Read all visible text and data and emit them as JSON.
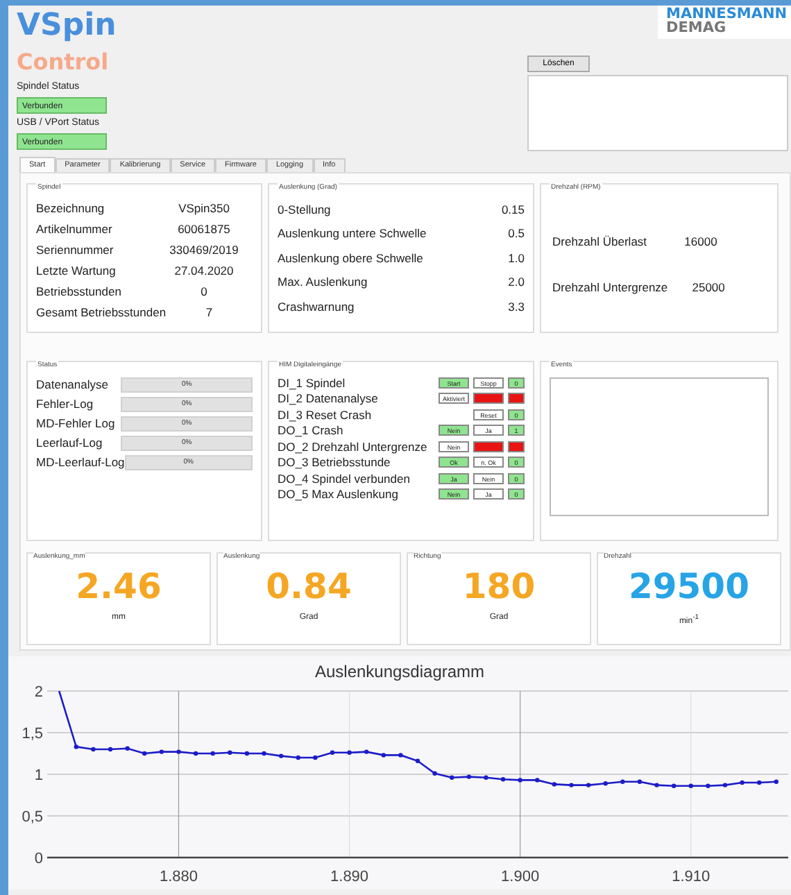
{
  "header": {
    "title": "VSpin",
    "subtitle": "Control",
    "logo": [
      "MANNESMANN",
      "DEMAG"
    ],
    "status_fields": [
      {
        "label": "Spindel Status",
        "value": "Verbunden"
      },
      {
        "label": "USB / VPort Status",
        "value": "Verbunden"
      }
    ],
    "clear_button": "Löschen"
  },
  "tabs": [
    {
      "label": "Start",
      "selected": true
    },
    {
      "label": "Parameter",
      "selected": false
    },
    {
      "label": "Kalibrierung",
      "selected": false
    },
    {
      "label": "Service",
      "selected": false
    },
    {
      "label": "Firmware",
      "selected": false
    },
    {
      "label": "Logging",
      "selected": false
    },
    {
      "label": "Info",
      "selected": false
    }
  ],
  "spindle": {
    "title": "Spindel",
    "rows": [
      {
        "label": "Bezeichnung",
        "value": "VSpin350"
      },
      {
        "label": "Artikelnummer",
        "value": "60061875"
      },
      {
        "label": "Seriennummer",
        "value": "330469/2019"
      },
      {
        "label": "Letzte Wartung",
        "value": "27.04.2020"
      },
      {
        "label": "Betriebsstunden",
        "value": "0"
      },
      {
        "label": "Gesamt Betriebsstunden",
        "value": "7"
      }
    ]
  },
  "deflection": {
    "title": "Auslenkung (Grad)",
    "rows": [
      {
        "label": "0-Stellung",
        "value": "0.15"
      },
      {
        "label": "Auslenkung untere Schwelle",
        "value": "0.5"
      },
      {
        "label": "Auslenkung obere Schwelle",
        "value": "1.0"
      },
      {
        "label": "Max. Auslenkung",
        "value": "2.0"
      },
      {
        "label": "Crashwarnung",
        "value": "3.3"
      }
    ]
  },
  "speed": {
    "title": "Drehzahl (RPM)",
    "rows": [
      {
        "label": "Drehzahl Überlast",
        "value": "16000"
      },
      {
        "label": "Drehzahl Untergrenze",
        "value": "25000"
      }
    ]
  },
  "status": {
    "title": "Status",
    "rows": [
      {
        "label": "Datenanalyse",
        "level": 0,
        "reading": "0%"
      },
      {
        "label": "Fehler-Log",
        "level": 0,
        "reading": "0%"
      },
      {
        "label": "MD-Fehler Log",
        "level": 0,
        "reading": "0%"
      },
      {
        "label": "Leerlauf-Log",
        "level": 0,
        "reading": "0%"
      },
      {
        "label": "MD-Leerlauf-Log",
        "level": 0,
        "reading": "0%"
      }
    ]
  },
  "io": {
    "title": "HIM Digitaleingänge",
    "rows": [
      {
        "label": "DI_1 Spindel",
        "cells": [
          {
            "text": "Start",
            "color": "#8fe48f"
          },
          {
            "text": "Stopp",
            "color": "#ffffff"
          },
          {
            "text": "0",
            "color": "#8fe48f"
          }
        ]
      },
      {
        "label": "DI_2 Datenanalyse",
        "cells": [
          {
            "text": "Aktiviert",
            "color": "#ffffff"
          },
          {
            "color": "#e81414"
          },
          {
            "color": "#e81414"
          }
        ]
      },
      {
        "label": "DI_3 Reset Crash",
        "cells": [
          "",
          {
            "text": "Reset",
            "color": "#ffffff"
          },
          {
            "text": "0",
            "color": "#8fe48f"
          }
        ]
      },
      {
        "label": "DO_1 Crash",
        "cells": [
          {
            "text": "Nein",
            "color": "#8fe48f"
          },
          {
            "text": "Ja",
            "color": "#ffffff"
          },
          {
            "text": "1",
            "color": "#8fe48f"
          }
        ]
      },
      {
        "label": "DO_2 Drehzahl Untergrenze",
        "cells": [
          {
            "text": "Nein",
            "color": "#ffffff"
          },
          {
            "color": "#e81414"
          },
          {
            "color": "#e81414"
          }
        ]
      },
      {
        "label": "DO_3 Betriebsstunde",
        "cells": [
          {
            "text": "Ok",
            "color": "#8fe48f"
          },
          {
            "text": "n. Ok",
            "color": "#ffffff"
          },
          {
            "text": "0",
            "color": "#8fe48f"
          }
        ]
      },
      {
        "label": "DO_4 Spindel verbunden",
        "cells": [
          {
            "text": "Ja",
            "color": "#8fe48f"
          },
          {
            "text": "Nein",
            "color": "#ffffff"
          },
          {
            "text": "0",
            "color": "#8fe48f"
          }
        ]
      },
      {
        "label": "DO_5 Max Auslenkung",
        "cells": [
          {
            "text": "Nein",
            "color": "#8fe48f"
          },
          {
            "text": "Ja",
            "color": "#ffffff"
          },
          {
            "text": "0",
            "color": "#8fe48f"
          }
        ]
      }
    ]
  },
  "events": {
    "title": "Events"
  },
  "cards": [
    {
      "title": "Auslenkung_mm",
      "value": "2.46",
      "unit": "mm",
      "color": "#f5a623"
    },
    {
      "title": "Auslenkung",
      "value": "0.84",
      "unit": "Grad",
      "color": "#f5a623"
    },
    {
      "title": "Richtung",
      "value": "180",
      "unit": "Grad",
      "color": "#f5a623"
    },
    {
      "title": "Drehzahl",
      "value": "29500",
      "unit": "min$^{-1}$",
      "color": "#27a4e6"
    }
  ],
  "chart": {
    "chart_data": {
      "type": "line",
      "title": "Auslenkungsdiagramm",
      "x": [
        1.873,
        1.874,
        1.875,
        1.876,
        1.877,
        1.878,
        1.879,
        1.88,
        1.881,
        1.882,
        1.883,
        1.884,
        1.885,
        1.886,
        1.887,
        1.888,
        1.889,
        1.89,
        1.891,
        1.892,
        1.893,
        1.894,
        1.895,
        1.896,
        1.897,
        1.898,
        1.899,
        1.9,
        1.901,
        1.902,
        1.903,
        1.904,
        1.905,
        1.906,
        1.907,
        1.908,
        1.909,
        1.91,
        1.911,
        1.912,
        1.913,
        1.914,
        1.915
      ],
      "grid": true,
      "series": [
        {
          "color": "#1c1cc8",
          "marker": "circle",
          "values": [
            2.0,
            1.33,
            1.3,
            1.3,
            1.31,
            1.25,
            1.27,
            1.27,
            1.25,
            1.25,
            1.26,
            1.25,
            1.25,
            1.22,
            1.2,
            1.2,
            1.26,
            1.26,
            1.27,
            1.23,
            1.23,
            1.16,
            1.01,
            0.96,
            0.97,
            0.96,
            0.94,
            0.93,
            0.93,
            0.88,
            0.87,
            0.87,
            0.89,
            0.91,
            0.91,
            0.87,
            0.86,
            0.86,
            0.86,
            0.87,
            0.9,
            0.9,
            0.91
          ]
        }
      ],
      "xlim": [
        1.8723,
        1.9157
      ],
      "ylim": [
        0,
        2
      ],
      "xticks": [
        {
          "value": 1.88,
          "label": "1.880"
        },
        {
          "value": 1.89,
          "label": "1.890"
        },
        {
          "value": 1.9,
          "label": "1.900"
        },
        {
          "value": 1.91,
          "label": "1.910"
        }
      ],
      "yticks": [
        {
          "value": 0,
          "label": "0"
        },
        {
          "value": 0.5,
          "label": "0,5"
        },
        {
          "value": 1,
          "label": "1"
        },
        {
          "value": 1.5,
          "label": "1,5"
        },
        {
          "value": 2,
          "label": "2"
        }
      ]
    }
  }
}
